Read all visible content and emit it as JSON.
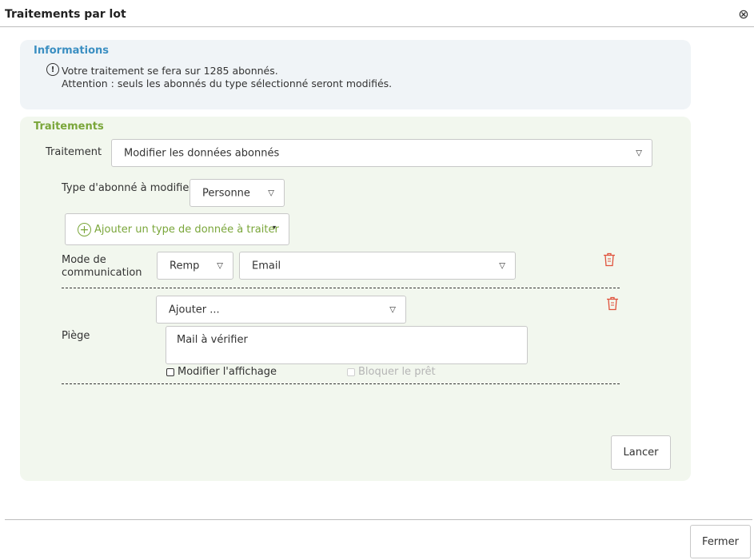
{
  "dialog": {
    "title": "Traitements par lot",
    "close_icon": "⊗"
  },
  "info": {
    "title": "Informations",
    "icon": "!",
    "line1": "Votre traitement se fera sur 1285 abonnés.",
    "line2": "Attention : seuls les abonnés du type sélectionné seront modifiés."
  },
  "treatments": {
    "title": "Traitements",
    "treatment_label": "Traitement",
    "treatment_value": "Modifier les données abonnés",
    "subscriber_type_label": "Type d'abonné à modifier",
    "subscriber_type_value": "Personne",
    "add_data_type_label": "Ajouter un type de donnée à traiter",
    "add_data_type_icon": "+",
    "dropdown_caret": "▽",
    "small_caret": "▾",
    "comm_mode_label_line1": "Mode de",
    "comm_mode_label_line2": "communication",
    "comm_mode_action_value": "Remp",
    "comm_mode_value": "Email",
    "add_select_value": "Ajouter ...",
    "trap_label": "Piège",
    "trap_text": "Mail à vérifier",
    "modify_display_label": "Modifier l'affichage",
    "block_loan_label": "Bloquer le prêt",
    "launch_label": "Lancer"
  },
  "footer": {
    "close_label": "Fermer"
  },
  "colors": {
    "info_title": "#3b8fc2",
    "treat_title": "#7aa63a",
    "trash": "#e0503a"
  }
}
